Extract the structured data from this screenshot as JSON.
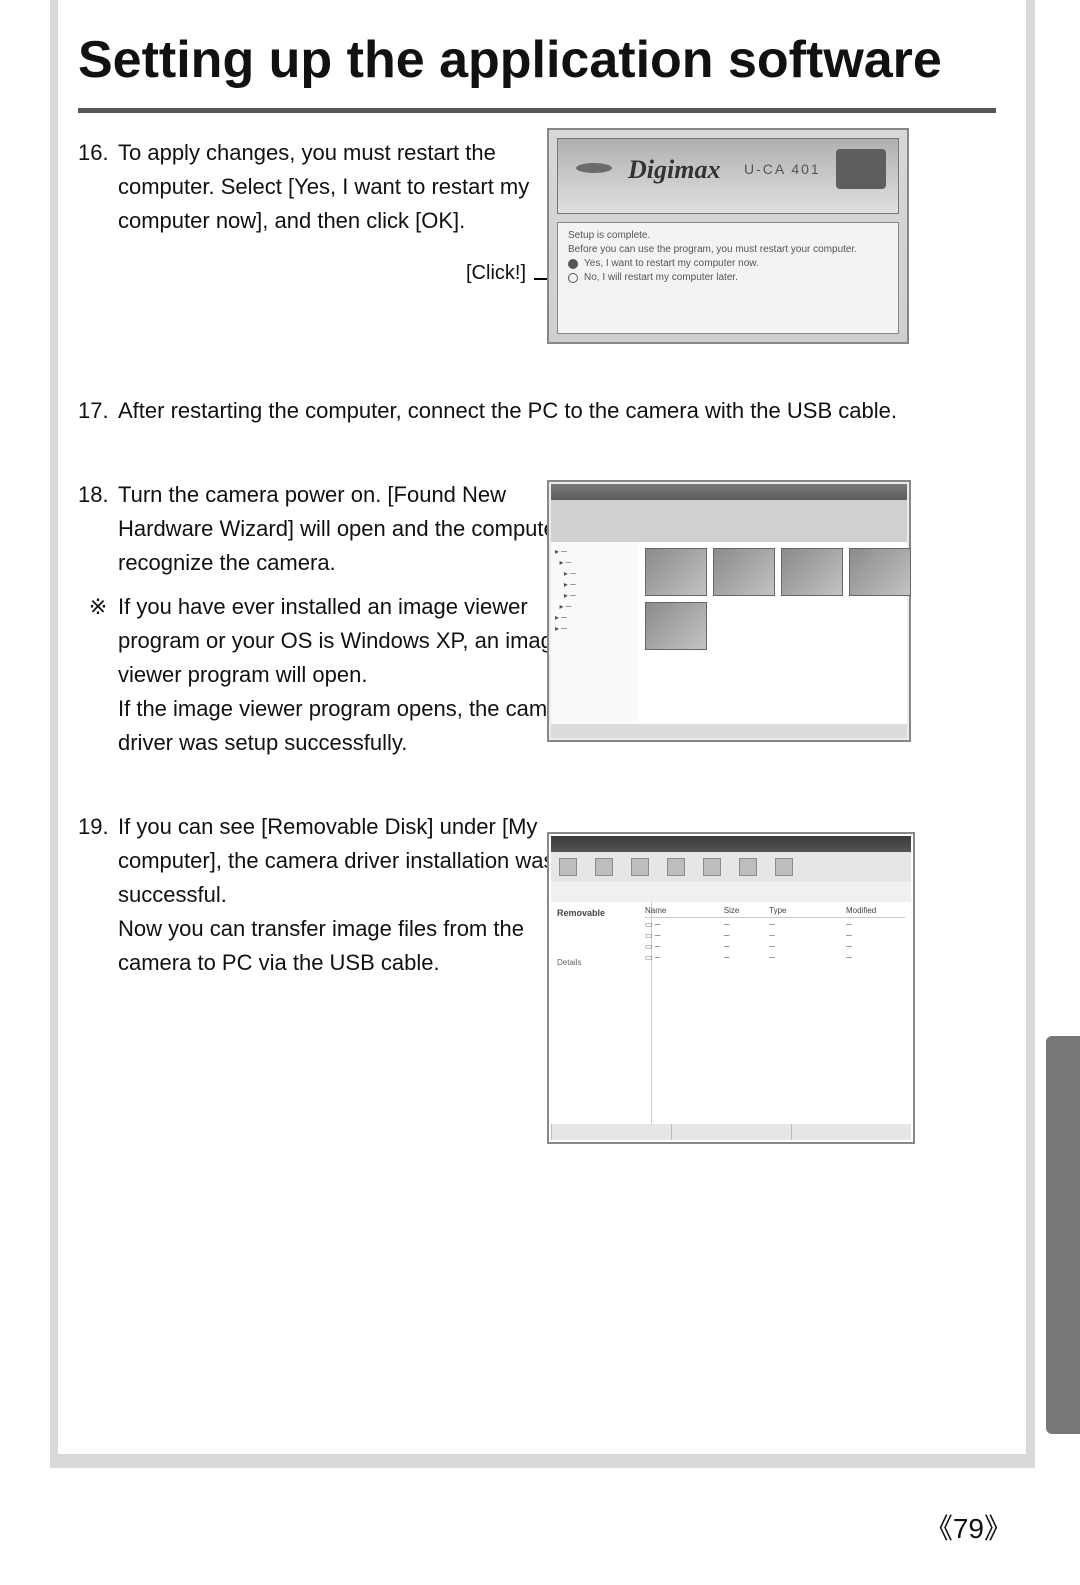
{
  "title": "Setting up the application software",
  "page_number": "79",
  "click_label": "[Click!]",
  "fig16": {
    "brand": "Digimax",
    "model": "U-CA 401",
    "line1": "Setup is complete.",
    "line2": "Before you can use the program, you must restart your computer.",
    "opt1": "Yes, I want to restart my computer now.",
    "opt2": "No, I will restart my computer later."
  },
  "step16": {
    "num": "16.",
    "l1": "To apply changes, you must restart the",
    "l2": "computer. Select [Yes, I want to restart my",
    "l3": "computer now], and then click [OK]."
  },
  "step17": {
    "num": "17.",
    "l1": "After restarting the computer, connect the PC to the camera with the USB cable."
  },
  "step18": {
    "num": "18.",
    "l1": "Turn the camera power on. [Found New",
    "l2": "Hardware Wizard] will open and the computer will",
    "l3": "recognize the camera."
  },
  "note18": {
    "mark": "※",
    "l1": "If you have ever installed an image viewer",
    "l2": "program or your OS is Windows XP, an image",
    "l3": "viewer program will open.",
    "l4": "If the image viewer program opens, the camera",
    "l5": "driver was setup successfully."
  },
  "step19": {
    "num": "19.",
    "l1": "If you can see [Removable Disk] under [My",
    "l2": "computer], the camera driver installation was",
    "l3": "successful.",
    "l4": "Now you can transfer image files from the",
    "l5": "camera to PC via the USB cable."
  },
  "fig19": {
    "side_title": "Removable",
    "side_task": "Details",
    "h_name": "Name",
    "h_size": "Size",
    "h_type": "Type",
    "h_mod": "Modified"
  }
}
